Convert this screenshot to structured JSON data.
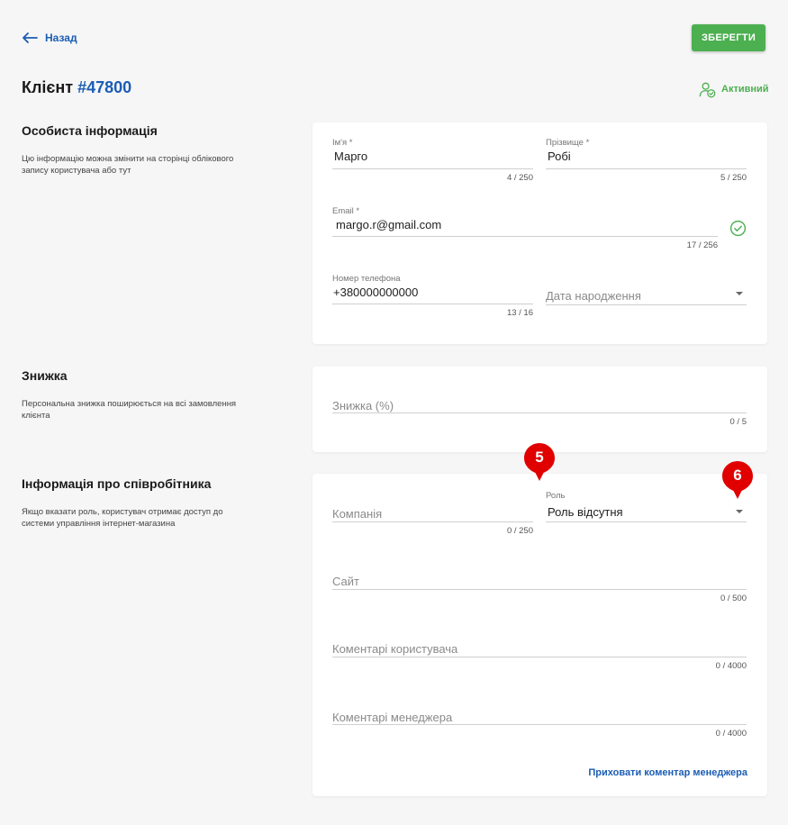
{
  "header": {
    "back_label": "Назад",
    "save_label": "ЗБЕРЕГТИ",
    "title_prefix": "Клієнт",
    "client_id": "#47800",
    "status": "Активний"
  },
  "personal": {
    "title": "Особиста інформація",
    "description": "Цю інформацію можна змінити на сторінці облікового запису користувача або тут",
    "first_name": {
      "label": "Ім'я *",
      "value": "Марго",
      "counter": "4 / 250"
    },
    "last_name": {
      "label": "Прізвище *",
      "value": "Робі",
      "counter": "5 / 250"
    },
    "email": {
      "label": "Email *",
      "value": "margo.r@gmail.com",
      "counter": "17 / 256"
    },
    "phone": {
      "label": "Номер телефона",
      "value": "+380000000000",
      "counter": "13 / 16"
    },
    "birth_date": {
      "placeholder": "Дата народження"
    }
  },
  "discount": {
    "title": "Знижка",
    "description": "Персональна знижка поширюється на всі замовлення клієнта",
    "field": {
      "placeholder": "Знижка (%)",
      "counter": "0 / 5"
    }
  },
  "employee": {
    "title": "Інформація про співробітника",
    "description": "Якщо вказати роль, користувач отримає доступ до системи управління інтернет-магазина",
    "company": {
      "placeholder": "Компанія",
      "counter": "0 / 250"
    },
    "role": {
      "label": "Роль",
      "value": "Роль відсутня"
    },
    "site": {
      "placeholder": "Сайт",
      "counter": "0 / 500"
    },
    "user_comments": {
      "placeholder": "Коментарі користувача",
      "counter": "0 / 4000"
    },
    "manager_comments": {
      "placeholder": "Коментарі менеджера",
      "counter": "0 / 4000"
    },
    "hide_manager_comment": "Приховати коментар менеджера"
  },
  "markers": [
    "5",
    "6"
  ],
  "colors": {
    "accent": "#1b5db4",
    "success": "#4caf50",
    "marker": "#e00000"
  }
}
